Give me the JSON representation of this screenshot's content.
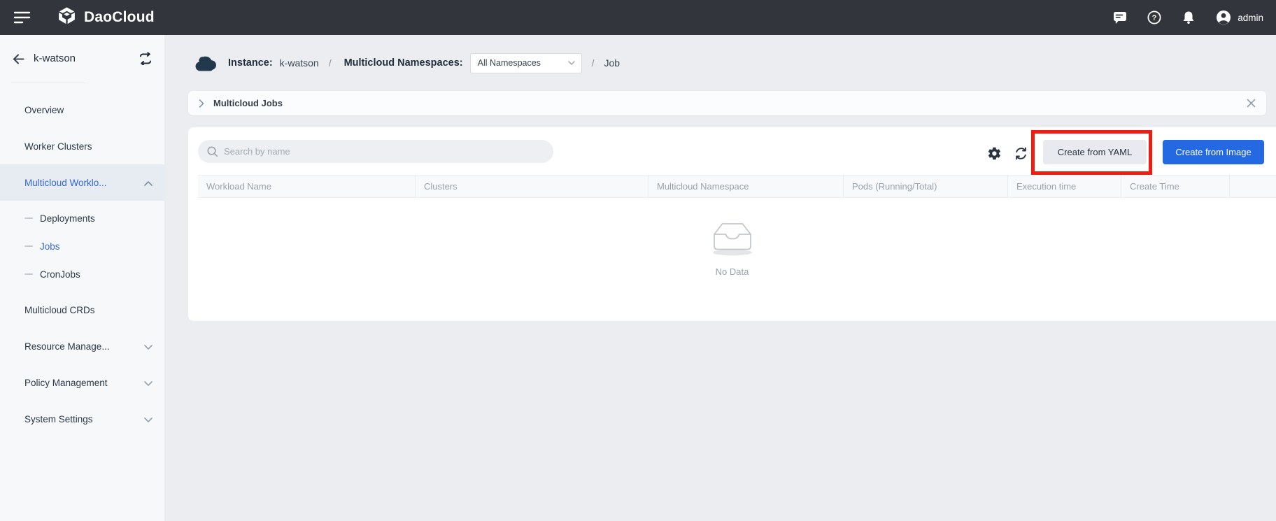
{
  "topbar": {
    "brand": "DaoCloud",
    "user": "admin"
  },
  "sidebar": {
    "instance_name": "k-watson",
    "items": [
      {
        "label": "Overview"
      },
      {
        "label": "Worker Clusters"
      },
      {
        "label": "Multicloud Worklo...",
        "active": true,
        "expanded": true
      },
      {
        "label": "Deployments",
        "sub": true
      },
      {
        "label": "Jobs",
        "sub": true,
        "active": true
      },
      {
        "label": "CronJobs",
        "sub": true
      },
      {
        "label": "Multicloud CRDs"
      },
      {
        "label": "Resource Manage...",
        "collapsible": true
      },
      {
        "label": "Policy Management",
        "collapsible": true
      },
      {
        "label": "System Settings",
        "collapsible": true
      }
    ]
  },
  "header": {
    "instance_label": "Instance:",
    "instance_value": "k-watson",
    "separator1": "/",
    "namespaces_label": "Multicloud Namespaces:",
    "namespaces_value": "All Namespaces",
    "separator2": "/",
    "page": "Job"
  },
  "tabbar": {
    "title": "Multicloud Jobs"
  },
  "toolbar": {
    "search_placeholder": "Search by name",
    "create_yaml_label": "Create from YAML",
    "create_image_label": "Create from Image"
  },
  "table": {
    "columns": [
      "Workload Name",
      "Clusters",
      "Multicloud Namespace",
      "Pods (Running/Total)",
      "Execution time",
      "Create Time"
    ],
    "empty_text": "No Data",
    "rows": []
  },
  "colors": {
    "topbar_bg": "#32363c",
    "accent_blue": "#3568d4",
    "primary_button": "#2569e2",
    "highlight_red": "#ee1d12",
    "sidebar_bg": "#f7f8fa",
    "page_bg": "#ebedf1"
  }
}
